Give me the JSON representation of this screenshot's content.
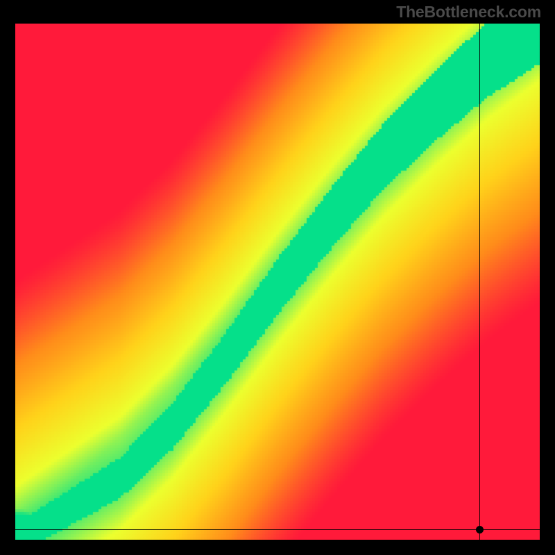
{
  "attribution": "TheBottleneck.com",
  "chart_data": {
    "type": "heatmap",
    "title": "",
    "xlabel": "",
    "ylabel": "",
    "xlim": [
      0,
      1
    ],
    "ylim": [
      0,
      1
    ],
    "colorscale": [
      "#ff1a3a",
      "#ff8c1a",
      "#ffd21a",
      "#ecff2e",
      "#05e08a"
    ],
    "optimal_ridge": [
      {
        "x": 0.0,
        "y": 0.0
      },
      {
        "x": 0.1,
        "y": 0.06
      },
      {
        "x": 0.2,
        "y": 0.12
      },
      {
        "x": 0.3,
        "y": 0.22
      },
      {
        "x": 0.4,
        "y": 0.35
      },
      {
        "x": 0.5,
        "y": 0.49
      },
      {
        "x": 0.6,
        "y": 0.62
      },
      {
        "x": 0.7,
        "y": 0.74
      },
      {
        "x": 0.8,
        "y": 0.84
      },
      {
        "x": 0.9,
        "y": 0.93
      },
      {
        "x": 1.0,
        "y": 1.0
      }
    ],
    "ridge_width": 0.06,
    "marker": {
      "x": 0.885,
      "y": 0.02
    },
    "crosshair": {
      "x": 0.885,
      "y": 0.02
    }
  }
}
